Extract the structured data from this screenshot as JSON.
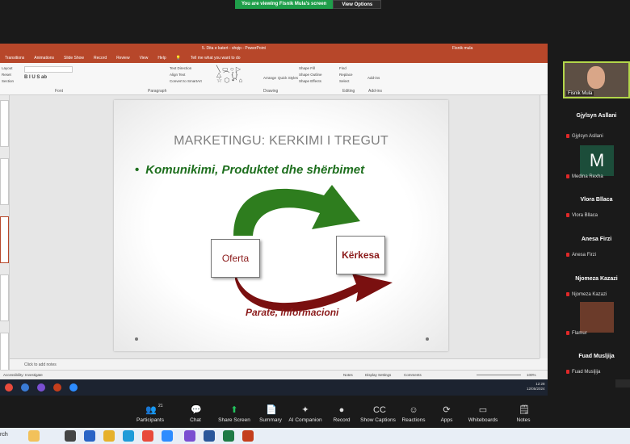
{
  "banner": {
    "viewing": "You are viewing Fisnik Mula's screen",
    "options": "View Options"
  },
  "ppt": {
    "doc_title": "5. Dita e katert - shqip  -  PowerPoint",
    "user": "Fisnik mula",
    "menu": [
      "Transitions",
      "Animations",
      "Slide Show",
      "Record",
      "Review",
      "View",
      "Help",
      "Tell me what you want to do"
    ],
    "ribbon": {
      "groups": [
        "Font",
        "Paragraph",
        "Drawing",
        "Editing",
        "Add-ins"
      ],
      "left_items": [
        "Layout",
        "Reset",
        "Section"
      ],
      "paragraph_items": [
        "Text Direction",
        "Align Text",
        "Convert to SmartArt"
      ],
      "drawing_items": [
        "Arrange",
        "Quick Styles",
        "Shape Fill",
        "Shape Outline",
        "Shape Effects"
      ],
      "editing_items": [
        "Find",
        "Replace",
        "Select"
      ],
      "addins_label": "Add-ins"
    },
    "slide": {
      "title": "MARKETINGU: KERKIMI I TREGUT",
      "bullet_dot": "•",
      "bullet": "Komunikimi, Produktet dhe shërbimet",
      "box_left": "Oferta",
      "box_right": "Kërkesa",
      "bottom_label": "Paratë, Informacioni"
    },
    "notes_placeholder": "Click to add notes",
    "status": {
      "accessibility": "Accessibility: Investigate",
      "notes": "Notes",
      "display": "Display Settings",
      "comments": "Comments",
      "zoom": "100%"
    },
    "clock_time": "12:28",
    "clock_date": "12/05/2024"
  },
  "participants": [
    {
      "name": "Fisnik Mula",
      "type": "self"
    },
    {
      "name": "Gjylsyn Asllani",
      "label": "Gjylsyn Asllani",
      "type": "name"
    },
    {
      "name": "Medina Rexha",
      "avatar": "M",
      "type": "avatar"
    },
    {
      "name": "Vlora Bllaca",
      "label": "Vlora Bllaca",
      "type": "name"
    },
    {
      "name": "Anesa Firzi",
      "label": "Anesa Firzi",
      "type": "name"
    },
    {
      "name": "Njomeza Kazazi",
      "label": "Njomeza Kazazi",
      "type": "name"
    },
    {
      "name": "Flamur",
      "type": "photo"
    },
    {
      "name": "Fuad Musljija",
      "label": "Fuad Musljija",
      "type": "name"
    }
  ],
  "toolbar": {
    "participants_count": "21",
    "items": [
      "Participants",
      "Chat",
      "Share Screen",
      "Summary",
      "AI Companion",
      "Record",
      "Show Captions",
      "Reactions",
      "Apps",
      "Whiteboards",
      "Notes"
    ]
  },
  "wintask": {
    "search": "rch"
  },
  "colors": {
    "ppt_red": "#b7472a",
    "green_arrow": "#2e7d1e",
    "dark_red_arrow": "#7a1010",
    "share_green": "#22c55e"
  }
}
